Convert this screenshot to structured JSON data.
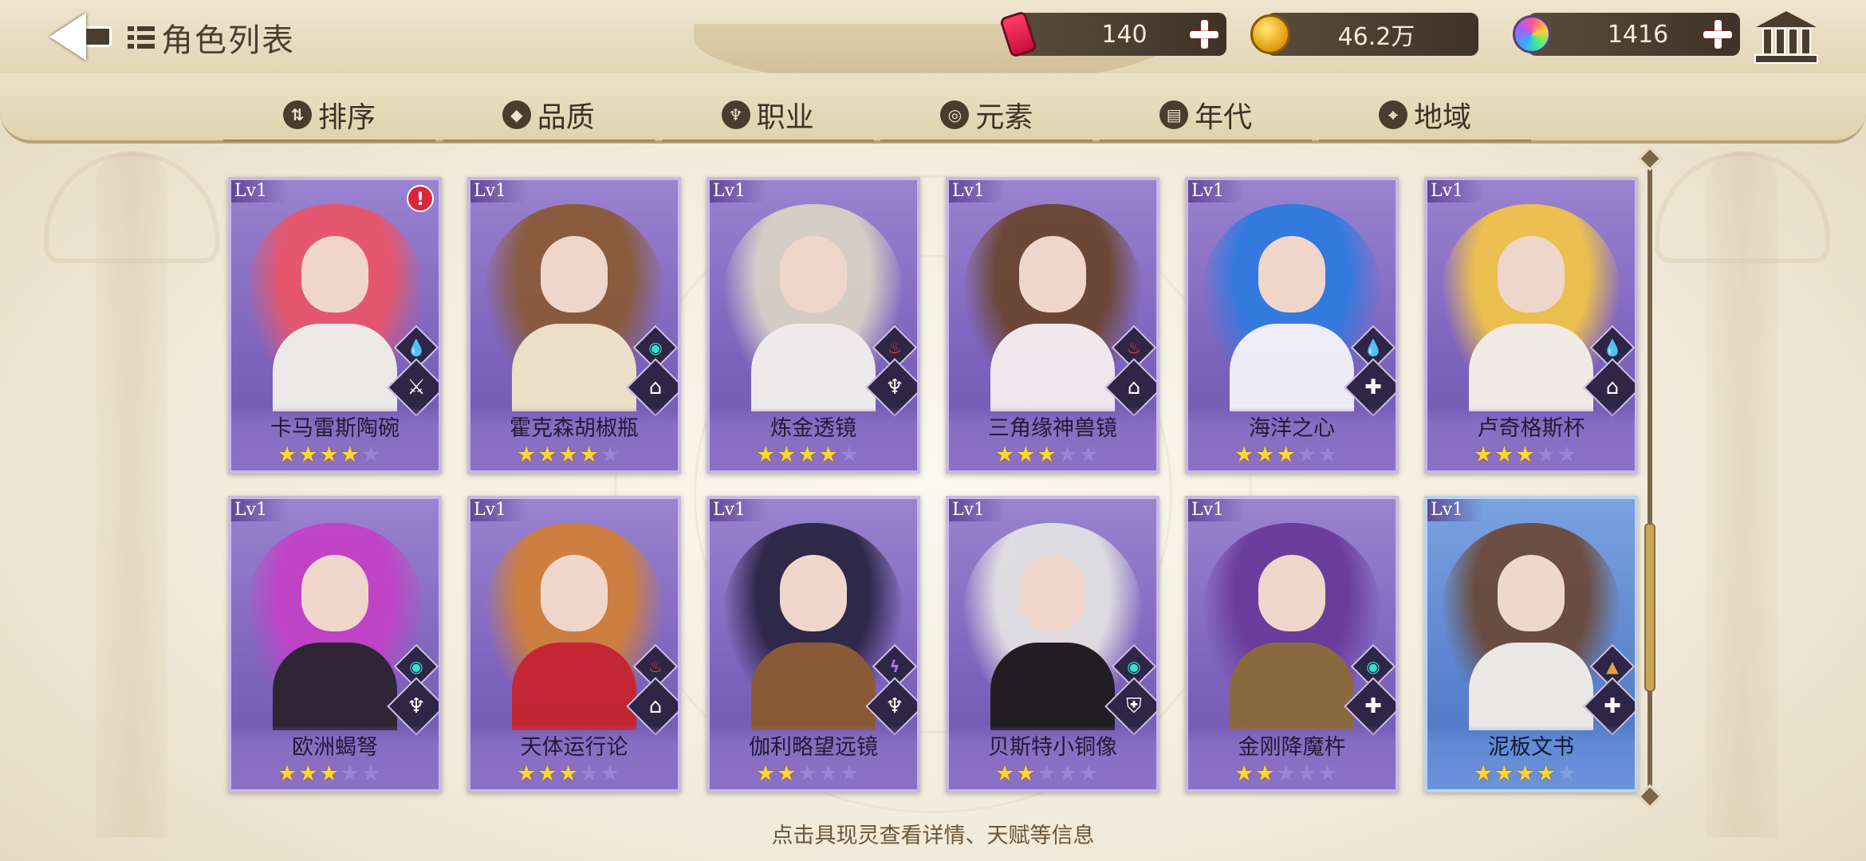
{
  "header": {
    "title": "角色列表",
    "currencies": [
      {
        "name": "stamina",
        "value": "140",
        "icon": "soda-can-icon"
      },
      {
        "name": "gold",
        "value": "46.2万",
        "icon": "gold-coin-icon"
      },
      {
        "name": "gems",
        "value": "1416",
        "icon": "rainbow-gem-icon"
      }
    ]
  },
  "filters": [
    {
      "label": "排序",
      "icon": "sort-icon"
    },
    {
      "label": "品质",
      "icon": "quality-icon"
    },
    {
      "label": "职业",
      "icon": "class-icon"
    },
    {
      "label": "元素",
      "icon": "element-icon"
    },
    {
      "label": "年代",
      "icon": "era-icon"
    },
    {
      "label": "地域",
      "icon": "location-pin-icon"
    }
  ],
  "cards": [
    {
      "level": "Lv1",
      "name": "卡马雷斯陶碗",
      "stars": 4,
      "element": "water",
      "role": "assassin",
      "alert": true,
      "frame": "purple",
      "hair": "#e9566b",
      "outfit": "#f2f0ea"
    },
    {
      "level": "Lv1",
      "name": "霍克森胡椒瓶",
      "stars": 4,
      "element": "wind",
      "role": "support",
      "alert": false,
      "frame": "purple",
      "hair": "#8a5a38",
      "outfit": "#f3e6c8"
    },
    {
      "level": "Lv1",
      "name": "炼金透镜",
      "stars": 4,
      "element": "fire",
      "role": "mage",
      "alert": false,
      "frame": "purple",
      "hair": "#d8d2c6",
      "outfit": "#f4f2ee"
    },
    {
      "level": "Lv1",
      "name": "三角缘神兽镜",
      "stars": 3,
      "element": "fire",
      "role": "support",
      "alert": false,
      "frame": "purple",
      "hair": "#6b4530",
      "outfit": "#f6eeee"
    },
    {
      "level": "Lv1",
      "name": "海洋之心",
      "stars": 3,
      "element": "water",
      "role": "healer",
      "alert": false,
      "frame": "purple",
      "hair": "#2f7ae0",
      "outfit": "#f4f4fa"
    },
    {
      "level": "Lv1",
      "name": "卢奇格斯杯",
      "stars": 3,
      "element": "water",
      "role": "support",
      "alert": false,
      "frame": "purple",
      "hair": "#f1c34a",
      "outfit": "#f7f2e8"
    },
    {
      "level": "Lv1",
      "name": "欧洲蝎弩",
      "stars": 3,
      "element": "wind",
      "role": "mage",
      "alert": false,
      "frame": "purple",
      "hair": "#c341c6",
      "outfit": "#2c2230"
    },
    {
      "level": "Lv1",
      "name": "天体运行论",
      "stars": 3,
      "element": "fire",
      "role": "support",
      "alert": false,
      "frame": "purple",
      "hair": "#d0803a",
      "outfit": "#c8242c"
    },
    {
      "level": "Lv1",
      "name": "伽利略望远镜",
      "stars": 2,
      "element": "thunder",
      "role": "mage",
      "alert": false,
      "frame": "purple",
      "hair": "#2a2544",
      "outfit": "#8a5a2e"
    },
    {
      "level": "Lv1",
      "name": "贝斯特小铜像",
      "stars": 2,
      "element": "wind",
      "role": "tank",
      "alert": false,
      "frame": "purple",
      "hair": "#e2e2e2",
      "outfit": "#1e1a1a"
    },
    {
      "level": "Lv1",
      "name": "金刚降魔杵",
      "stars": 2,
      "element": "wind",
      "role": "healer",
      "alert": false,
      "frame": "purple",
      "hair": "#6a3a9a",
      "outfit": "#8c6a3a"
    },
    {
      "level": "Lv1",
      "name": "泥板文书",
      "stars": 4,
      "element": "earth",
      "role": "healer",
      "alert": false,
      "frame": "blue",
      "hair": "#6b4a3a",
      "outfit": "#f2eee8"
    }
  ],
  "max_stars": 5,
  "element_styles": {
    "water": {
      "glyph": "💧",
      "color": "#3aa0ff",
      "icon": "water-drop-icon"
    },
    "wind": {
      "glyph": "◉",
      "color": "#38e0d0",
      "icon": "wind-swirl-icon"
    },
    "fire": {
      "glyph": "♨",
      "color": "#ff4a2a",
      "icon": "fire-flame-icon"
    },
    "thunder": {
      "glyph": "ϟ",
      "color": "#b070ff",
      "icon": "thunder-icon"
    },
    "earth": {
      "glyph": "▲",
      "color": "#e0a24a",
      "icon": "earth-mountain-icon"
    }
  },
  "role_styles": {
    "assassin": {
      "glyph": "⚔",
      "icon": "crossed-blades-icon"
    },
    "support": {
      "glyph": "⌂",
      "icon": "support-tower-icon"
    },
    "mage": {
      "glyph": "♆",
      "icon": "trident-mage-icon"
    },
    "healer": {
      "glyph": "✚",
      "icon": "healer-cross-icon"
    },
    "tank": {
      "glyph": "⛨",
      "icon": "shield-tank-icon"
    }
  },
  "hint": "点击具现灵查看详情、天赋等信息"
}
